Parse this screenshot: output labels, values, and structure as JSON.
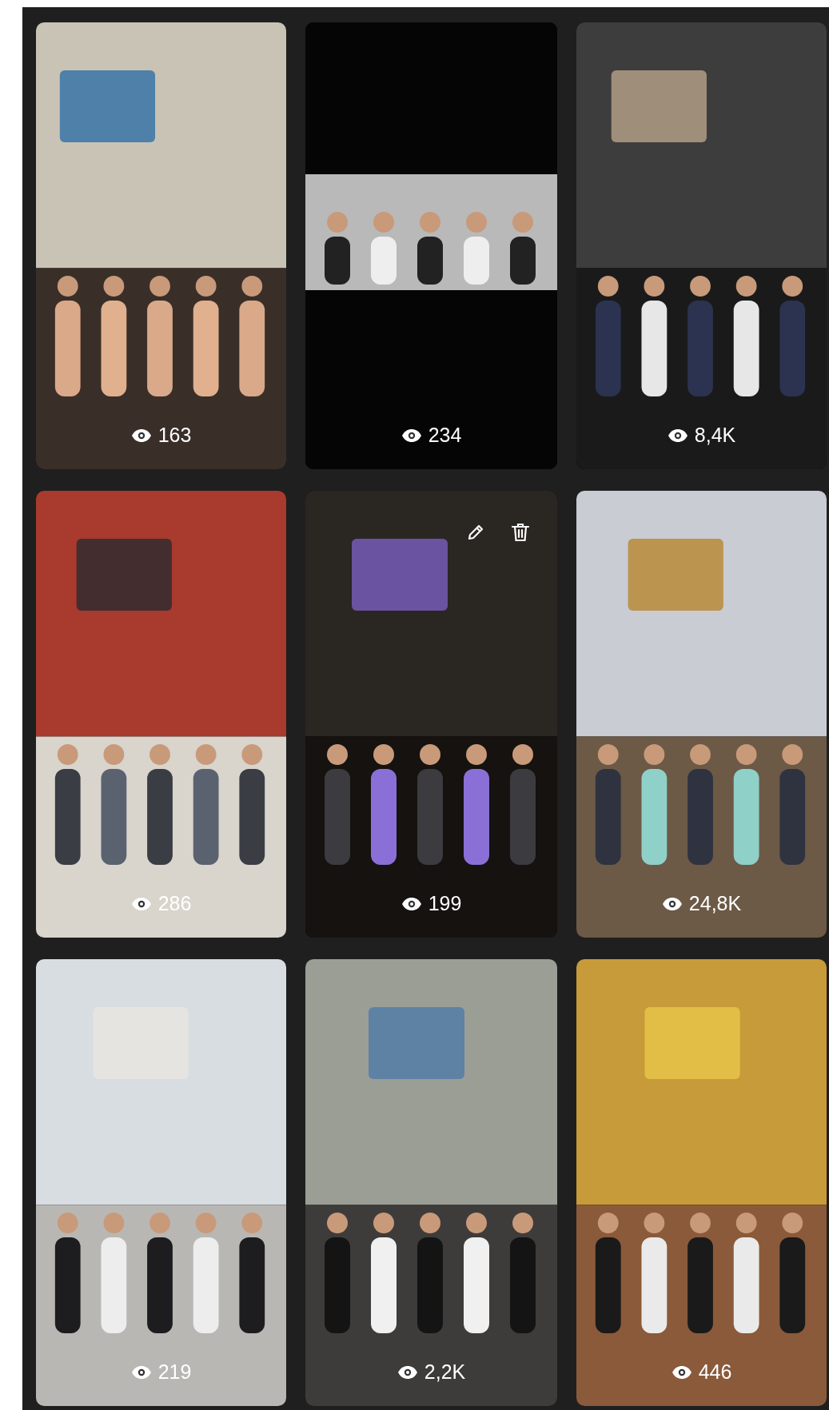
{
  "stories": [
    {
      "views": "163",
      "editable": false
    },
    {
      "views": "234",
      "editable": false
    },
    {
      "views": "8,4K",
      "editable": false
    },
    {
      "views": "286",
      "editable": false
    },
    {
      "views": "199",
      "editable": true
    },
    {
      "views": "24,8K",
      "editable": false
    },
    {
      "views": "219",
      "editable": false
    },
    {
      "views": "2,2K",
      "editable": false
    },
    {
      "views": "446",
      "editable": false
    }
  ]
}
